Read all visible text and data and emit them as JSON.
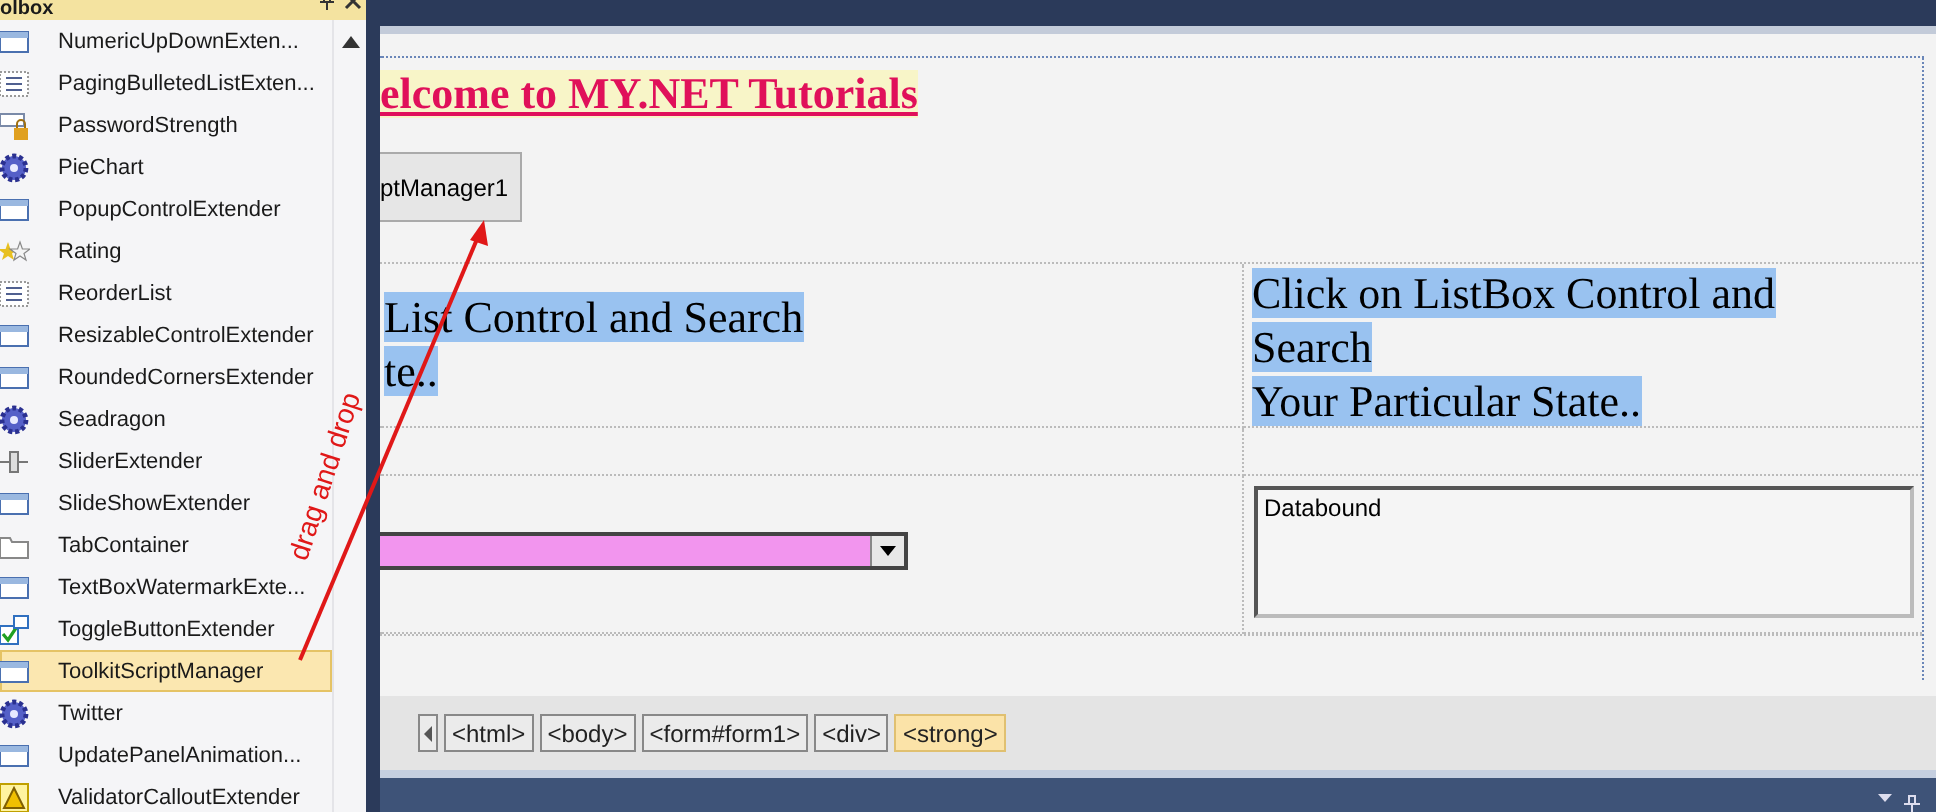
{
  "toolbox": {
    "title": "olbox",
    "items": [
      {
        "label": "NumericUpDownExten...",
        "kind": "control",
        "selected": false
      },
      {
        "label": "PagingBulletedListExten...",
        "kind": "list",
        "selected": false
      },
      {
        "label": "PasswordStrength",
        "kind": "lock",
        "selected": false
      },
      {
        "label": "PieChart",
        "kind": "gear",
        "selected": false
      },
      {
        "label": "PopupControlExtender",
        "kind": "control",
        "selected": false
      },
      {
        "label": "Rating",
        "kind": "star",
        "selected": false
      },
      {
        "label": "ReorderList",
        "kind": "list",
        "selected": false
      },
      {
        "label": "ResizableControlExtender",
        "kind": "control",
        "selected": false
      },
      {
        "label": "RoundedCornersExtender",
        "kind": "control",
        "selected": false
      },
      {
        "label": "Seadragon",
        "kind": "gear",
        "selected": false
      },
      {
        "label": "SliderExtender",
        "kind": "slider",
        "selected": false
      },
      {
        "label": "SlideShowExtender",
        "kind": "control",
        "selected": false
      },
      {
        "label": "TabContainer",
        "kind": "folder",
        "selected": false
      },
      {
        "label": "TextBoxWatermarkExte...",
        "kind": "control",
        "selected": false
      },
      {
        "label": "ToggleButtonExtender",
        "kind": "check",
        "selected": false
      },
      {
        "label": "ToolkitScriptManager",
        "kind": "control",
        "selected": true
      },
      {
        "label": "Twitter",
        "kind": "gear",
        "selected": false
      },
      {
        "label": "UpdatePanelAnimation...",
        "kind": "control",
        "selected": false
      },
      {
        "label": "ValidatorCalloutExtender",
        "kind": "warning",
        "selected": false
      }
    ]
  },
  "designer": {
    "heading": "elcome to MY.NET Tutorials",
    "script_manager": "ptManager1",
    "left_cell_lines": [
      "List Control and Search",
      "te.."
    ],
    "right_cell_lines": [
      "Click on ListBox Control and",
      "Search",
      "Your Particular State.."
    ],
    "listbox": {
      "items": [
        "Databound"
      ]
    }
  },
  "tag_path": [
    {
      "label": "<html>",
      "selected": false
    },
    {
      "label": "<body>",
      "selected": false
    },
    {
      "label": "<form#form1>",
      "selected": false
    },
    {
      "label": "<div>",
      "selected": false
    },
    {
      "label": "<strong>",
      "selected": true
    }
  ],
  "annotation": {
    "text": "drag and drop"
  }
}
